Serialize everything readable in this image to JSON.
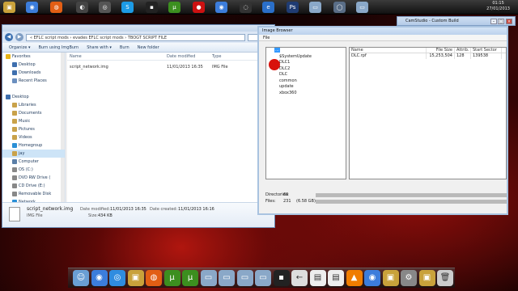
{
  "colors": {
    "accent": "#3399ff",
    "cursor_highlight": "#d8120c"
  },
  "taskbar": {
    "icons": [
      "folder-icon",
      "chrome-icon",
      "firefox-icon",
      "media-icon",
      "camstudio-icon",
      "skype-icon",
      "terminal-icon",
      "utorrent-icon",
      "record-icon",
      "chrome-icon",
      "steam-icon",
      "ie-icon",
      "folder-icon",
      "photoshop-icon",
      "window-icon",
      "window-icon",
      "globe-icon",
      "window-icon"
    ],
    "clock_time": "01:15",
    "clock_date": "27/01/2013"
  },
  "camstudio": {
    "title": "CamStudio - Custom Build"
  },
  "explorer": {
    "address": "« EFLC script mods › evades EFLC script mods › TBOGT SCRIPT FILE",
    "commands": [
      "Organize ▾",
      "Burn using ImgBurn",
      "Share with ▾",
      "Burn",
      "New folder"
    ],
    "nav": [
      {
        "label": "Favorites",
        "sub": false,
        "icon": "star-icon",
        "color": "#e8b417"
      },
      {
        "label": "Desktop",
        "sub": true,
        "icon": "desktop-icon",
        "color": "#3e6fae"
      },
      {
        "label": "Downloads",
        "sub": true,
        "icon": "downloads-icon",
        "color": "#3e6fae"
      },
      {
        "label": "Recent Places",
        "sub": true,
        "icon": "recent-icon",
        "color": "#6b8fbf"
      },
      {
        "label": "",
        "sub": false,
        "icon": "",
        "color": ""
      },
      {
        "label": "Desktop",
        "sub": false,
        "icon": "desktop-icon",
        "color": "#3e6fae"
      },
      {
        "label": "Libraries",
        "sub": true,
        "icon": "library-icon",
        "color": "#c9a24a"
      },
      {
        "label": "Documents",
        "sub": true,
        "icon": "documents-icon",
        "color": "#c9a24a"
      },
      {
        "label": "Music",
        "sub": true,
        "icon": "music-icon",
        "color": "#c9a24a"
      },
      {
        "label": "Pictures",
        "sub": true,
        "icon": "pictures-icon",
        "color": "#c9a24a"
      },
      {
        "label": "Videos",
        "sub": true,
        "icon": "videos-icon",
        "color": "#c9a24a"
      },
      {
        "label": "Homegroup",
        "sub": true,
        "icon": "homegroup-icon",
        "color": "#2a8fd6"
      },
      {
        "label": "jay",
        "sub": true,
        "icon": "user-icon",
        "color": "#c9a24a",
        "selected": true
      },
      {
        "label": "Computer",
        "sub": true,
        "icon": "computer-icon",
        "color": "#5b7fa8"
      },
      {
        "label": "OS (C:)",
        "sub": true,
        "icon": "drive-icon",
        "color": "#888888"
      },
      {
        "label": "DVD RW Drive (",
        "sub": true,
        "icon": "dvd-icon",
        "color": "#888888"
      },
      {
        "label": "CD Drive (E:)",
        "sub": true,
        "icon": "cd-icon",
        "color": "#888888"
      },
      {
        "label": "Removable Disk",
        "sub": true,
        "icon": "usb-icon",
        "color": "#888888"
      },
      {
        "label": "Network",
        "sub": true,
        "icon": "network-icon",
        "color": "#2a8fd6"
      }
    ],
    "columns": [
      "Name",
      "Date modified",
      "Type"
    ],
    "files": [
      {
        "name": "script_network.img",
        "date": "11/01/2013 16:35",
        "type": "IMG File"
      }
    ],
    "details": {
      "filename": "script_network.img",
      "modified_label": "Date modified:",
      "modified_value": "11/01/2013 16:35",
      "created_label": "Date created:",
      "created_value": "11/01/2013 16:16",
      "type": "IMG File",
      "size_label": "Size:",
      "size_value": "434 KB"
    }
  },
  "image_browser": {
    "title": "Image Browser",
    "menu": "File",
    "tree": [
      {
        "label": "...",
        "level": 1,
        "selected": true
      },
      {
        "label": "$SystemUpdate",
        "level": 2
      },
      {
        "label": "DLC1",
        "level": 2
      },
      {
        "label": "DLC2",
        "level": 2
      },
      {
        "label": "DLC",
        "level": 2
      },
      {
        "label": "common",
        "level": 2
      },
      {
        "label": "update",
        "level": 2
      },
      {
        "label": "xbox360",
        "level": 2
      }
    ],
    "list_columns": [
      "Name",
      "File Size",
      "Attrib.",
      "Start Sector"
    ],
    "list_rows": [
      {
        "name": "DLC.rpf",
        "size": "15,253,504",
        "attrib": "128",
        "sector": "139538"
      }
    ],
    "stats": {
      "directories_label": "Directories:",
      "directories_value": "69",
      "files_label": "Files:",
      "files_value": "231",
      "files_size": "(6.58 GB)"
    }
  },
  "dock": {
    "icons": [
      "finder-icon",
      "chrome-icon",
      "safari-icon",
      "folder-icon",
      "firefox-icon",
      "utorrent-icon",
      "utorrent-icon",
      "window-icon",
      "window-icon",
      "window-icon",
      "window-icon",
      "terminal-icon",
      "back-arrow-icon",
      "document-icon",
      "document-icon",
      "vlc-icon",
      "chrome-icon",
      "folder-icon",
      "settings-icon",
      "folder-icon",
      "trash-icon"
    ]
  }
}
